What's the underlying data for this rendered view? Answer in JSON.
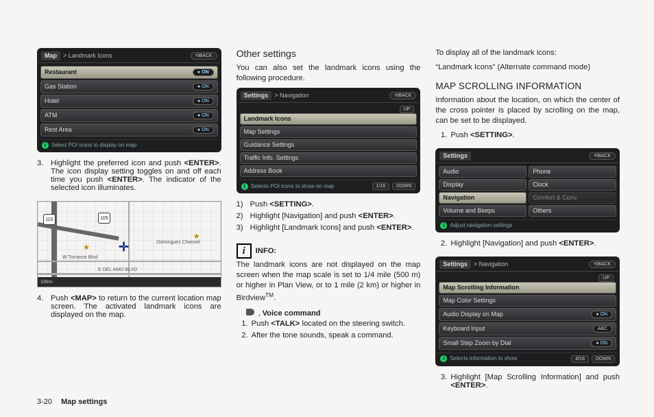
{
  "ui1": {
    "tag": "Map",
    "crumb": "> Landmark Icons",
    "back": "⟲BACK",
    "items": [
      {
        "label": "Restaurant",
        "pill": "● ON",
        "hl": true
      },
      {
        "label": "Gas Station",
        "pill": "● ON"
      },
      {
        "label": "Hotel",
        "pill": "● ON"
      },
      {
        "label": "ATM",
        "pill": "● ON"
      },
      {
        "label": "Rest Area",
        "pill": "● ON"
      }
    ],
    "footer": "Select POI icons to display on map"
  },
  "step3": {
    "n": "3.",
    "text_a": "Highlight the preferred icon and push ",
    "enter": "<ENTER>",
    "text_b": ". The icon display setting toggles on and off each time you push ",
    "text_c": ". The indicator of the selected icon illuminates."
  },
  "map": {
    "shieldA": "110",
    "shieldB": "105",
    "labelA": "Dominguez Channel",
    "labelB": "W Torrance Blvd",
    "labelC": "E DEL AMO BLVD",
    "scale": "1/8mi"
  },
  "step4": {
    "n": "4.",
    "a": "Push ",
    "map": "<MAP>",
    "b": " to return to the current location map screen. The activated landmark icons are displayed on the map."
  },
  "other_h": "Other settings",
  "other_p": "You can also set the landmark icons using the following procedure.",
  "ui2": {
    "tag": "Settings",
    "crumb": "> Navigation",
    "back": "⟲BACK",
    "up": "UP",
    "items": [
      {
        "label": "Landmark Icons",
        "hl": true
      },
      {
        "label": "Map Settings"
      },
      {
        "label": "Guidance Settings"
      },
      {
        "label": "Traffic Info. Settings"
      },
      {
        "label": "Address Book"
      }
    ],
    "count": "1/16",
    "down": "DOWN",
    "footer": "Selects POI icons to show on map"
  },
  "oproc": {
    "s1a": "Push ",
    "s1b": "<SETTING>",
    "s1c": ".",
    "s2a": "Highlight [Navigation] and push ",
    "s2b": "<ENTER>",
    "s2c": ".",
    "s3a": "Highlight [Landmark Icons] and push ",
    "s3b": "<ENTER>",
    "s3c": "."
  },
  "info_label": "INFO:",
  "info_p_a": "The landmark icons are not displayed on the map screen when the map scale is set to 1/4 mile (500 m) or higher in Plan View, or to 1 mile (2 km) or higher in Birdview",
  "info_p_tm": "TM",
  "info_p_b": ".",
  "voice_h": "Voice command",
  "voice": {
    "s1a": "Push ",
    "s1b": "<TALK>",
    "s1c": " located on the steering switch.",
    "s2": "After the tone sounds, speak a command."
  },
  "col3_top_a": "To display all of the landmark icons:",
  "col3_top_b": "“Landmark Icons” (Alternate command mode)",
  "scroll_h": "MAP SCROLLING INFORMATION",
  "scroll_p": "Information about the location, on which the center of the cross pointer is placed by scrolling on the map, can be set to be displayed.",
  "sp1a": "Push ",
  "sp1b": "<SETTING>",
  "sp1c": ".",
  "ui3": {
    "tag": "Settings",
    "back": "⟲BACK",
    "left": [
      {
        "label": "Audio"
      },
      {
        "label": "Display"
      },
      {
        "label": "Navigation",
        "hl": true
      },
      {
        "label": "Volume and Beeps"
      }
    ],
    "right": [
      {
        "label": "Phone"
      },
      {
        "label": "Clock"
      },
      {
        "label": "Comfort & Conv.",
        "dim": true
      },
      {
        "label": "Others"
      }
    ],
    "footer": "Adjust navigation settings"
  },
  "sp2a": "Highlight [Navigation] and push ",
  "sp2b": "<ENTER>",
  "sp2c": ".",
  "ui4": {
    "tag": "Settings",
    "crumb": "> Navigation",
    "back": "⟲BACK",
    "up": "UP",
    "items": [
      {
        "label": "Map Scrolling Information",
        "hl": true
      },
      {
        "label": "Map Color Settings"
      },
      {
        "label": "Audio Display on Map",
        "pill": "● ON"
      },
      {
        "label": "Keyboard Input",
        "pill": "ABC"
      },
      {
        "label": "Small Step Zoom by Dial",
        "pill": "● ON"
      }
    ],
    "count": "4/16",
    "down": "DOWN",
    "footer": "Selects information to show"
  },
  "sp3a": "Highlight [Map Scrolling Information] and push ",
  "sp3b": "<ENTER>",
  "sp3c": ".",
  "page_no": "3-20",
  "section": "Map settings"
}
